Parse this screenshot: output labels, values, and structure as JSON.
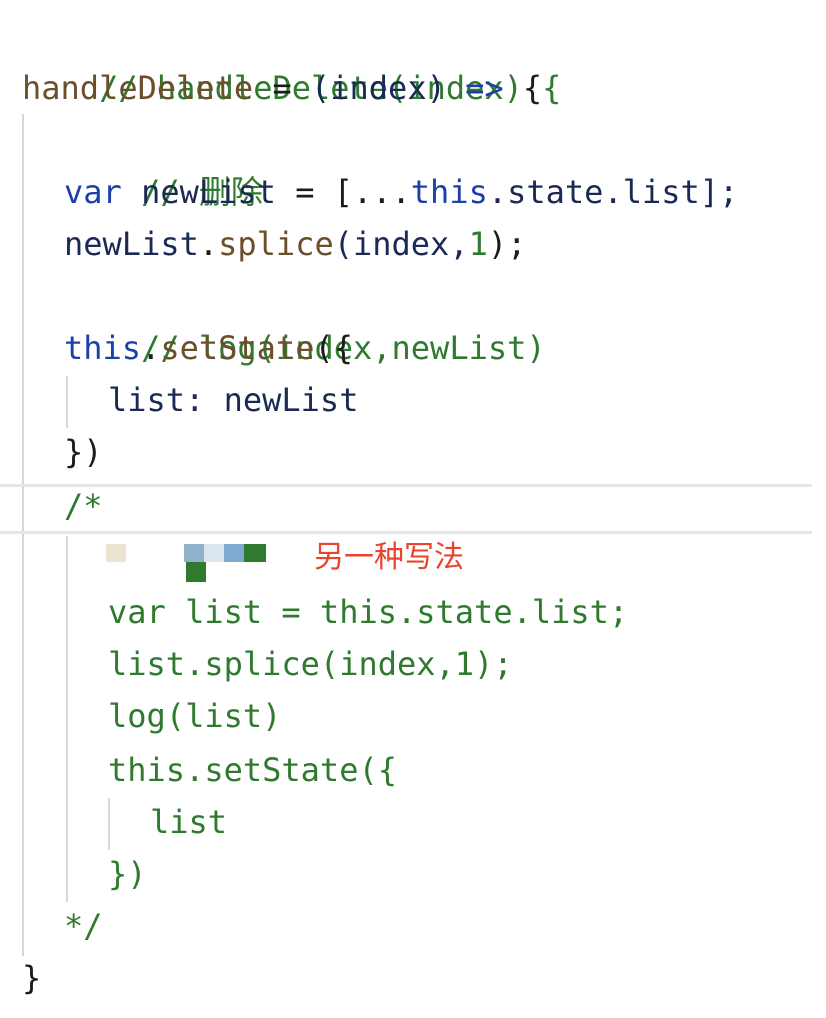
{
  "code": {
    "l1": {
      "comment": "// handleDelete(index) {"
    },
    "l2": {
      "name": "handleDelete",
      "eq": " = ",
      "params": "(index)",
      "arrow": " => ",
      "brace": "{"
    },
    "l3": {
      "comment": "// 删除"
    },
    "l4": {
      "kw": "var",
      "sp": " ",
      "ident": "newList",
      "eq": " = ",
      "open": "[...",
      "this": "this",
      "rest": ".state.list];"
    },
    "l5": {
      "ident": "newList",
      "dot": ".",
      "fn": "splice",
      "open": "(index,",
      "num": "1",
      "close": ");"
    },
    "l6": {
      "comment": "// log(index,newList)"
    },
    "l7": {
      "this": "this",
      "dot": ".",
      "fn": "setState",
      "open": "({"
    },
    "l8": {
      "text": "list: newList"
    },
    "l9": {
      "text": "})"
    },
    "l10": {
      "text": "/*"
    },
    "l12": {
      "text": "var list = this.state.list;"
    },
    "l13": {
      "text": "list.splice(index,1);"
    },
    "l14": {
      "text": "log(list)"
    },
    "l15": {
      "text": "this.setState({"
    },
    "l16": {
      "text": "list"
    },
    "l17": {
      "text": "})"
    },
    "l18": {
      "text": "*/"
    },
    "l19": {
      "text": "}"
    }
  },
  "annotation": {
    "text": "另一种写法"
  },
  "colors": {
    "comment": "#2f7a2f",
    "keyword": "#1d3fa8",
    "function": "#6b4f2a",
    "annotation": "#e8452c"
  }
}
